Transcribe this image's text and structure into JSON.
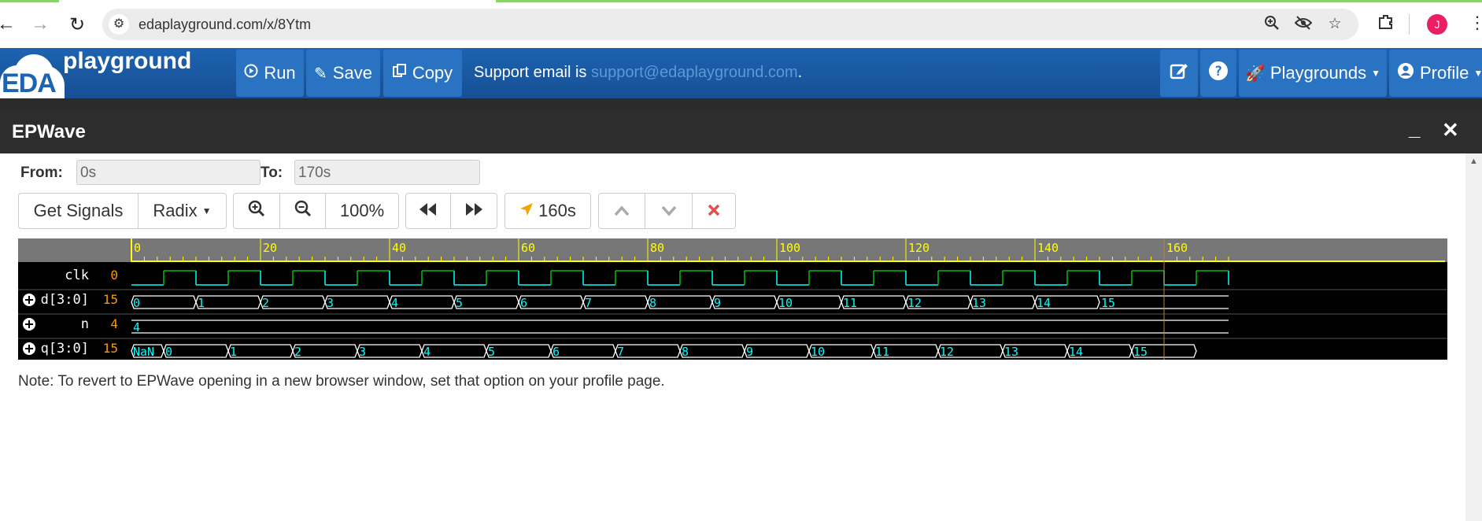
{
  "browser": {
    "url": "edaplayground.com/x/8Ytm",
    "back_icon": "←",
    "forward_icon": "→",
    "reload_icon": "↻",
    "avatar_letter": "J"
  },
  "header": {
    "logo_eda": "EDA",
    "logo_playground": "playground",
    "run_label": "Run",
    "save_label": "Save",
    "copy_label": "Copy",
    "support_text": "Support email is ",
    "support_email": "support@edaplayground.com",
    "support_period": ".",
    "playgrounds_label": "Playgrounds",
    "profile_label": "Profile"
  },
  "epwave": {
    "title": "EPWave",
    "from_label": "From:",
    "from_value": "0s",
    "to_label": "To:",
    "to_value": "170s",
    "get_signals_label": "Get Signals",
    "radix_label": "Radix",
    "zoom_label": "100%",
    "cursor_label": "160s",
    "note": "Note: To revert to EPWave opening in a new browser window, set that option on your profile page."
  },
  "waveform": {
    "time_ticks": [
      "0",
      "20",
      "40",
      "60",
      "80",
      "100",
      "120",
      "140",
      "160"
    ],
    "tick_values": [
      0,
      20,
      40,
      60,
      80,
      100,
      120,
      140,
      160
    ],
    "time_range": [
      0,
      170
    ],
    "cursor_time": 160,
    "signals": [
      {
        "name": "clk",
        "value": "0",
        "expandable": false
      },
      {
        "name": "d[3:0]",
        "value": "15",
        "expandable": true
      },
      {
        "name": "n",
        "value": "4",
        "expandable": true
      },
      {
        "name": "q[3:0]",
        "value": "15",
        "expandable": true
      }
    ],
    "d_values": [
      "0",
      "1",
      "2",
      "3",
      "4",
      "5",
      "6",
      "7",
      "8",
      "9",
      "10",
      "11",
      "12",
      "13",
      "14",
      "15"
    ],
    "n_value": "4",
    "q_values": [
      "NaN",
      "0",
      "1",
      "2",
      "3",
      "4",
      "5",
      "6",
      "7",
      "8",
      "9",
      "10",
      "11",
      "12",
      "13",
      "14",
      "15"
    ],
    "colors": {
      "tick": "#ffff00",
      "wave": "#00ffff",
      "clk_high": "#00c000",
      "value_orange": "#ff9900",
      "cursor": "#c08030"
    }
  }
}
